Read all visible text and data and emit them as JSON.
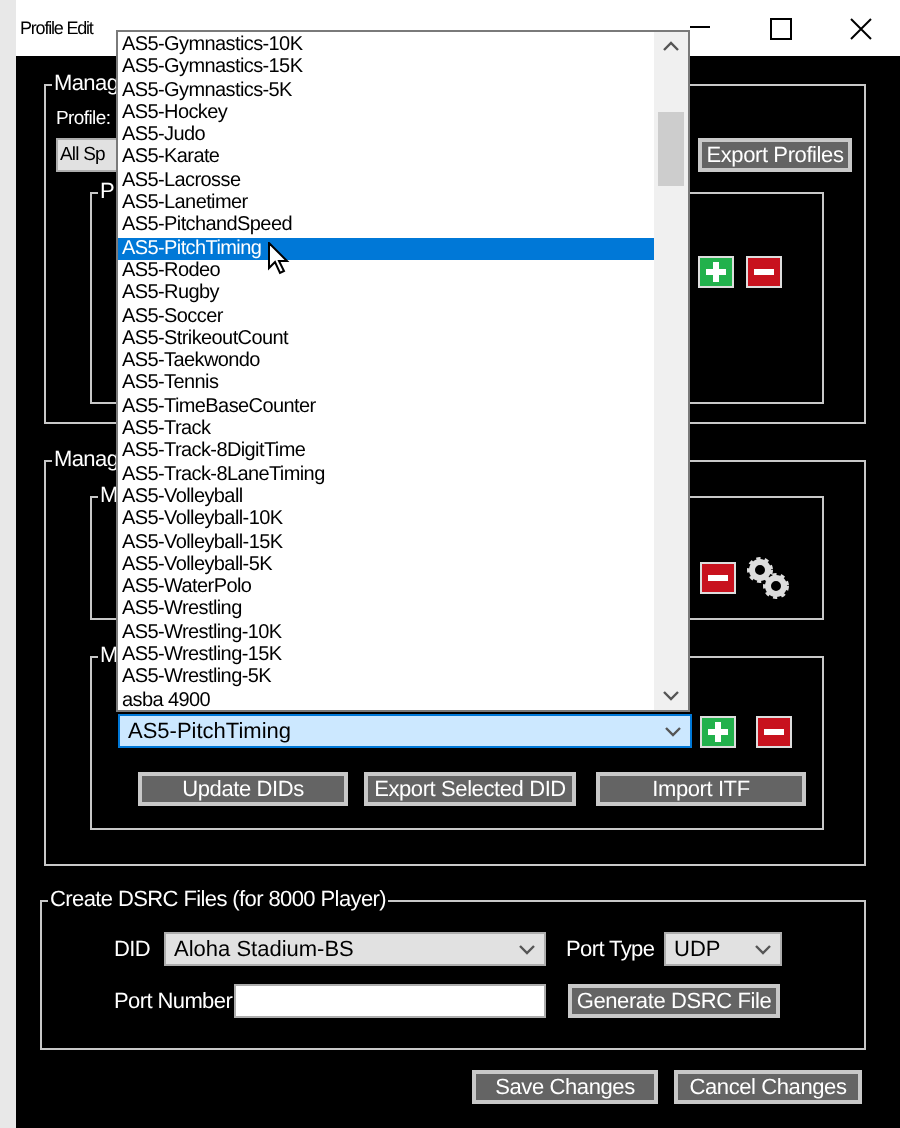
{
  "window": {
    "title": "Profile Edit"
  },
  "manage_profiles": {
    "title": "Manag",
    "profile_label": "Profile:",
    "profile_combo": {
      "value": "All Sp"
    },
    "export_button": "Export Profiles",
    "inner_group_title": "P"
  },
  "manage_dids": {
    "title": "Manag",
    "group_1_title": "M",
    "group_2_title": "M",
    "did_combo": {
      "value": "AS5-PitchTiming",
      "focused": true
    },
    "buttons": [
      "Update DIDs",
      "Export Selected DID",
      "Import ITF"
    ]
  },
  "dropdown_list": {
    "items": [
      {
        "label": "AS5-Gymnastics-10K",
        "selected": false
      },
      {
        "label": "AS5-Gymnastics-15K",
        "selected": false
      },
      {
        "label": "AS5-Gymnastics-5K",
        "selected": false
      },
      {
        "label": "AS5-Hockey",
        "selected": false
      },
      {
        "label": "AS5-Judo",
        "selected": false
      },
      {
        "label": "AS5-Karate",
        "selected": false
      },
      {
        "label": "AS5-Lacrosse",
        "selected": false
      },
      {
        "label": "AS5-Lanetimer",
        "selected": false
      },
      {
        "label": "AS5-PitchandSpeed",
        "selected": false
      },
      {
        "label": "AS5-PitchTiming",
        "selected": true
      },
      {
        "label": "AS5-Rodeo",
        "selected": false
      },
      {
        "label": "AS5-Rugby",
        "selected": false
      },
      {
        "label": "AS5-Soccer",
        "selected": false
      },
      {
        "label": "AS5-StrikeoutCount",
        "selected": false
      },
      {
        "label": "AS5-Taekwondo",
        "selected": false
      },
      {
        "label": "AS5-Tennis",
        "selected": false
      },
      {
        "label": "AS5-TimeBaseCounter",
        "selected": false
      },
      {
        "label": "AS5-Track",
        "selected": false
      },
      {
        "label": "AS5-Track-8DigitTime",
        "selected": false
      },
      {
        "label": "AS5-Track-8LaneTiming",
        "selected": false
      },
      {
        "label": "AS5-Volleyball",
        "selected": false
      },
      {
        "label": "AS5-Volleyball-10K",
        "selected": false
      },
      {
        "label": "AS5-Volleyball-15K",
        "selected": false
      },
      {
        "label": "AS5-Volleyball-5K",
        "selected": false
      },
      {
        "label": "AS5-WaterPolo",
        "selected": false
      },
      {
        "label": "AS5-Wrestling",
        "selected": false
      },
      {
        "label": "AS5-Wrestling-10K",
        "selected": false
      },
      {
        "label": "AS5-Wrestling-15K",
        "selected": false
      },
      {
        "label": "AS5-Wrestling-5K",
        "selected": false
      },
      {
        "label": "asba 4900",
        "selected": false
      }
    ]
  },
  "create_dsrc": {
    "title": "Create DSRC Files (for 8000 Player)",
    "did_label": "DID",
    "did_combo": {
      "value": "Aloha Stadium-BS"
    },
    "port_type_label": "Port Type",
    "port_type_combo": {
      "value": "UDP"
    },
    "port_number_label": "Port Number",
    "generate_button": "Generate DSRC File"
  },
  "footer_buttons": [
    "Save Changes",
    "Cancel Changes"
  ]
}
